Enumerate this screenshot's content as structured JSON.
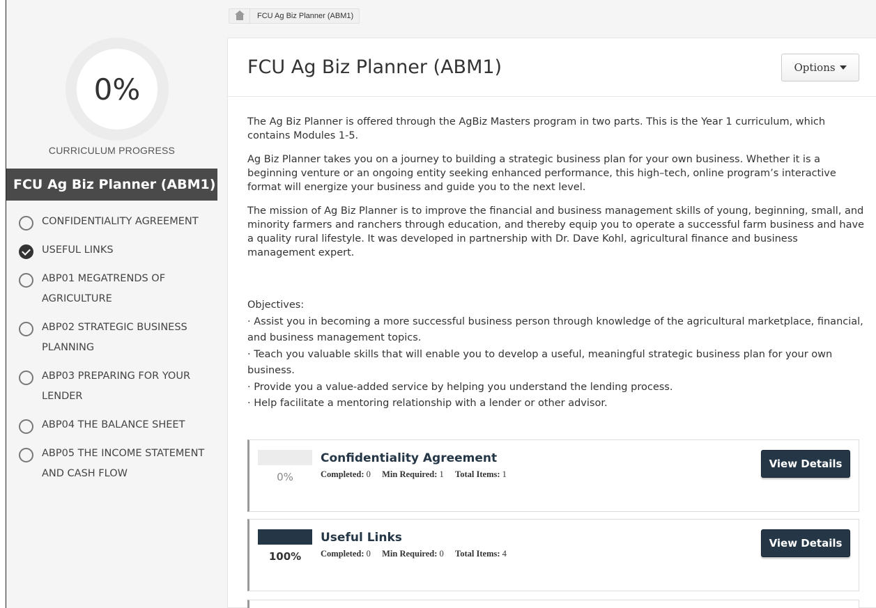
{
  "breadcrumb": {
    "home_icon": "home-icon",
    "current": "FCU Ag Biz Planner (ABM1)"
  },
  "sidebar": {
    "progress_value": "0%",
    "progress_label": "CURRICULUM PROGRESS",
    "title": "FCU Ag Biz Planner (ABM1)",
    "items": [
      {
        "label": "CONFIDENTIALITY AGREEMENT",
        "status": "incomplete"
      },
      {
        "label": "USEFUL LINKS",
        "status": "complete"
      },
      {
        "label": "ABP01 MEGATRENDS OF AGRICULTURE",
        "status": "incomplete"
      },
      {
        "label": "ABP02 STRATEGIC BUSINESS PLANNING",
        "status": "incomplete"
      },
      {
        "label": "ABP03 PREPARING FOR YOUR LENDER",
        "status": "incomplete"
      },
      {
        "label": "ABP04 THE BALANCE SHEET",
        "status": "incomplete"
      },
      {
        "label": "ABP05 THE INCOME STATEMENT AND CASH FLOW",
        "status": "incomplete"
      }
    ]
  },
  "main": {
    "title": "FCU Ag Biz Planner (ABM1)",
    "options_label": "Options",
    "paragraphs": [
      "The Ag Biz Planner is offered through the AgBiz Masters program in two parts.  This is the Year 1 curriculum, which contains Modules 1-5.",
      "Ag Biz Planner takes you on a journey to building a strategic business plan for your own business. Whether it is a beginning venture or an ongoing entity seeking enhanced performance, this high–tech, online program’s interactive format will energize your business and guide you to the next level.",
      "The mission of Ag Biz Planner is to improve the financial and business management skills of young, beginning, small, and minority farmers and ranchers through education, and thereby equip you to operate a successful farm business and have a quality rural lifestyle. It was developed in partnership with Dr. Dave Kohl, agricultural finance and business management expert."
    ],
    "objectives_heading": "Objectives:",
    "objectives": [
      "· Assist you in becoming a more successful business person through knowledge of the agricultural marketplace, financial, and business management topics.",
      "· Teach you valuable skills that will enable you to develop a useful, meaningful strategic business plan for your own business.",
      "· Provide you a value-added service by helping you understand the lending process.",
      "· Help facilitate a mentoring relationship with a lender or other advisor."
    ],
    "modules": [
      {
        "title": "Confidentiality Agreement",
        "progress": 0,
        "progress_label": "0%",
        "completed_label": "Completed:",
        "completed": "0",
        "min_label": "Min Required:",
        "min": "1",
        "total_label": "Total Items:",
        "total": "1",
        "button": "View Details"
      },
      {
        "title": "Useful Links",
        "progress": 100,
        "progress_label": "100%",
        "completed_label": "Completed:",
        "completed": "0",
        "min_label": "Min Required:",
        "min": "0",
        "total_label": "Total Items:",
        "total": "4",
        "button": "View Details"
      }
    ]
  },
  "colors": {
    "accent": "#253746",
    "sidebar_header": "#4a4a4a",
    "background": "#f5f5f5"
  }
}
